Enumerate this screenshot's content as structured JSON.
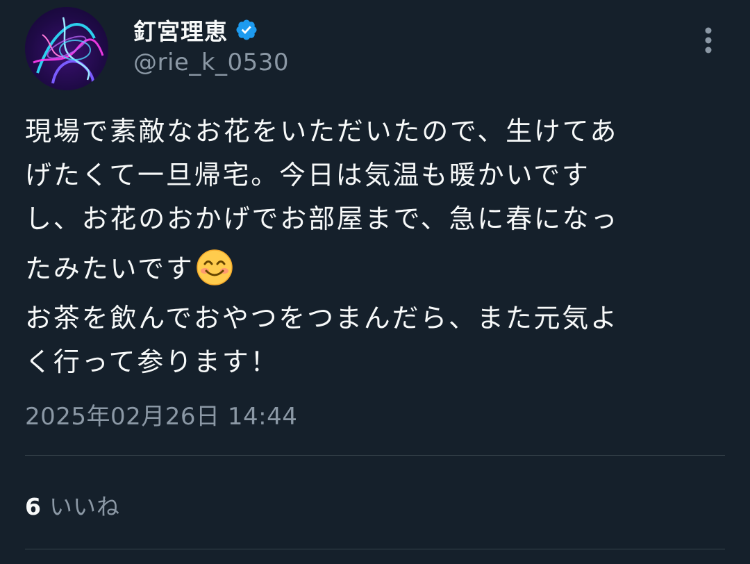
{
  "colors": {
    "background": "#15202b",
    "text_primary": "#f7f9f9",
    "text_secondary": "#8b98a5",
    "verified_badge": "#1d9bf0",
    "divider": "#38444d"
  },
  "author": {
    "display_name": "釘宮理恵",
    "handle": "@rie_k_0530",
    "verified": true,
    "avatar_icon": "profile-avatar-neon-art",
    "verified_icon": "verified-badge-icon"
  },
  "menu": {
    "icon": "more-vertical-icon"
  },
  "tweet": {
    "lines": [
      "現場で素敵なお花をいただいたので、生けてあ",
      "げたくて一旦帰宅。今日は気温も暖かいです",
      "し、お花のおかげでお部屋まで、急に春になっ",
      "たみたいです",
      "お茶を飲んでおやつをつまんだら、また元気よ",
      "く行って参ります！"
    ],
    "emoji": "smiling-face-emoji",
    "timestamp": "2025年02月26日 14:44"
  },
  "stats": {
    "likes_count": "6",
    "likes_label": "いいね"
  }
}
